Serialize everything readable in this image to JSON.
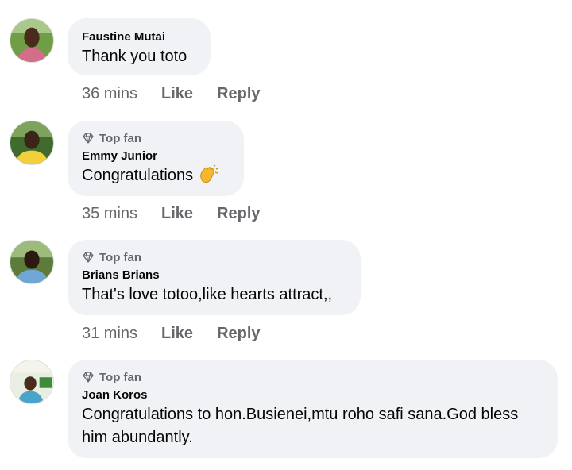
{
  "comments": [
    {
      "top_fan": "",
      "author": "Faustine Mutai",
      "text": "Thank you toto",
      "time": "36 mins",
      "like": "Like",
      "reply": "Reply"
    },
    {
      "top_fan": "Top fan",
      "author": "Emmy Junior",
      "text": "Congratulations",
      "emoji": "clapping-hands-emoji",
      "time": "35 mins",
      "like": "Like",
      "reply": "Reply"
    },
    {
      "top_fan": "Top fan",
      "author": "Brians Brians",
      "text": "That's love totoo,like hearts attract,,",
      "time": "31 mins",
      "like": "Like",
      "reply": "Reply"
    },
    {
      "top_fan": "Top fan",
      "author": "Joan Koros",
      "text_line1": "Congratulations to hon.Busienei,mtu roho safi sana.God bless",
      "text_line2": "him abundantly."
    }
  ],
  "icons": {
    "top_fan_badge": "diamond-icon"
  },
  "colors": {
    "bubble": "#f0f2f5",
    "meta_text": "#65676b",
    "text": "#050505"
  }
}
